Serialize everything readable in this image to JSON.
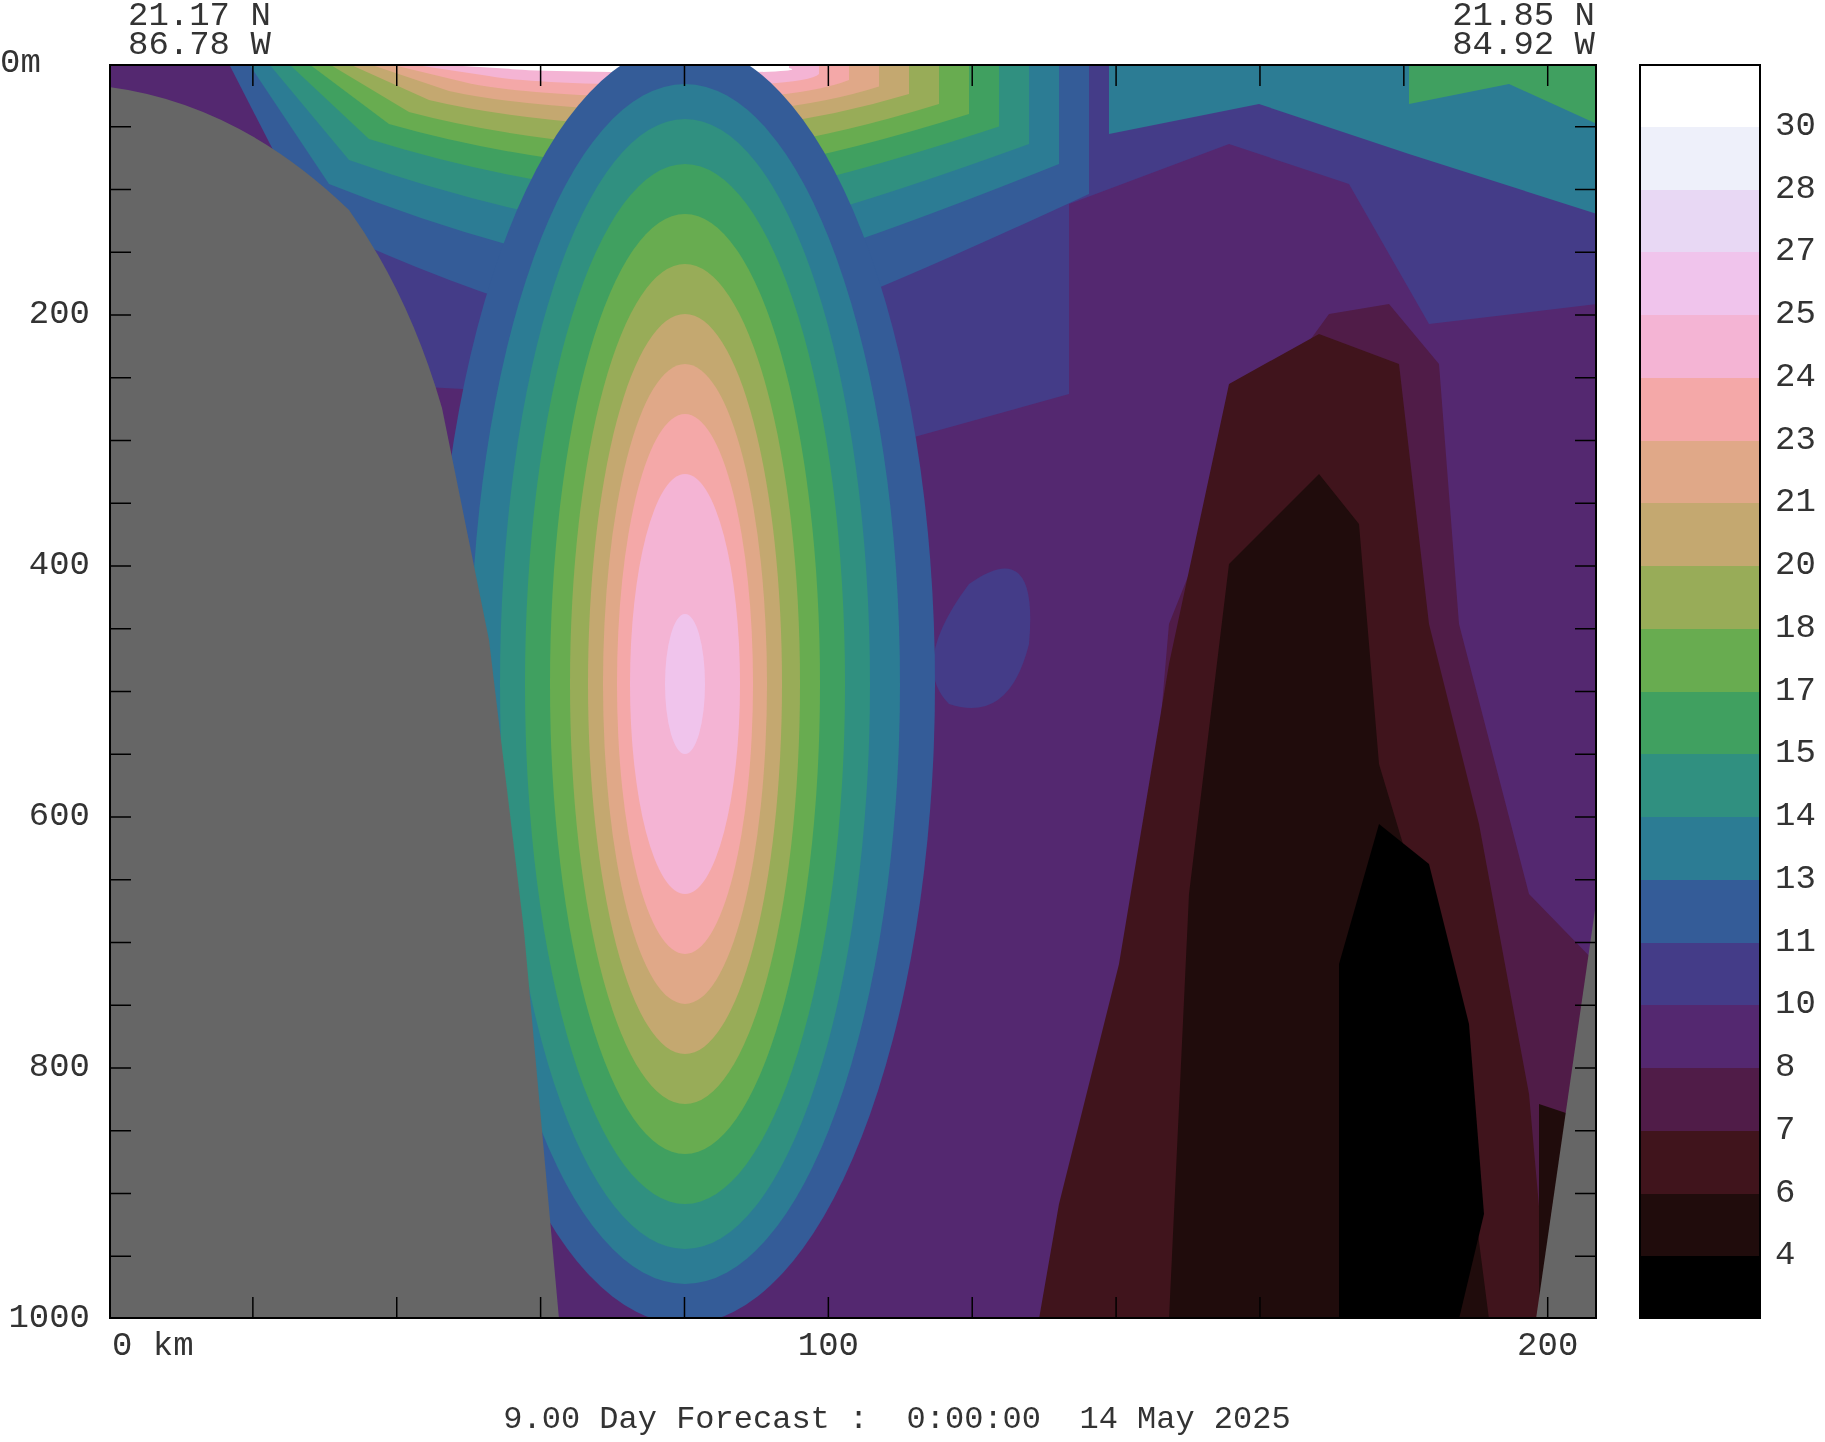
{
  "corner_labels": {
    "left": [
      "21.17 N",
      "86.78 W"
    ],
    "right": [
      "21.85 N",
      "84.92 W"
    ]
  },
  "y_axis": {
    "labels": [
      "0m",
      "200",
      "400",
      "600",
      "800",
      "1000"
    ]
  },
  "x_axis": {
    "labels": [
      "0 km",
      "100",
      "200"
    ]
  },
  "colorbar": {
    "bands": [
      {
        "color": "#ffffff"
      },
      {
        "color": "#eef0fa",
        "label": "30"
      },
      {
        "color": "#e8d8f4",
        "label": "28"
      },
      {
        "color": "#f0c4ec",
        "label": "27"
      },
      {
        "color": "#f4b4d4",
        "label": "25"
      },
      {
        "color": "#f4a8a8",
        "label": "24"
      },
      {
        "color": "#e0a888",
        "label": "23"
      },
      {
        "color": "#c4a870",
        "label": "21"
      },
      {
        "color": "#98ac58",
        "label": "20"
      },
      {
        "color": "#68ac50",
        "label": "18"
      },
      {
        "color": "#40a060",
        "label": "17"
      },
      {
        "color": "#309080",
        "label": "15"
      },
      {
        "color": "#2c7c94",
        "label": "14"
      },
      {
        "color": "#345c98",
        "label": "13"
      },
      {
        "color": "#443c88",
        "label": "11"
      },
      {
        "color": "#542870",
        "label": "10"
      },
      {
        "color": "#501c48",
        "label": "8"
      },
      {
        "color": "#40141c",
        "label": "7"
      },
      {
        "color": "#200c0c",
        "label": "6"
      },
      {
        "color": "#000000",
        "label": "4"
      }
    ]
  },
  "caption": "9.00 Day Forecast :  0:00:00  14 May 2025"
}
